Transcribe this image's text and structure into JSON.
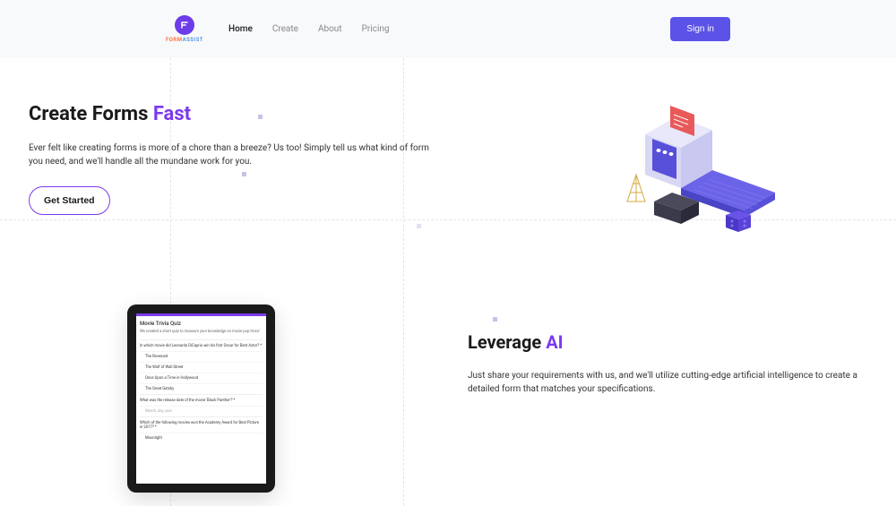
{
  "header": {
    "logo_text_1": "FORM",
    "logo_text_2": "ASSIST",
    "nav": [
      "Home",
      "Create",
      "About",
      "Pricing"
    ],
    "signin": "Sign in"
  },
  "hero": {
    "title_prefix": "Create Forms ",
    "title_highlight": "Fast",
    "description": "Ever felt like creating forms is more of a chore than a breeze? Us too! Simply tell us what kind of form you need, and we'll handle all the mundane work for you.",
    "cta": "Get Started"
  },
  "section2": {
    "title_prefix": "Leverage ",
    "title_highlight": "AI",
    "description": "Just share your requirements with us, and we'll utilize cutting-edge artificial intelligence to create a detailed form that matches your specifications."
  },
  "tablet": {
    "title": "Movie Trivia Quiz",
    "subtitle": "We created a short quiz to measure your knowledge on movie pop trivia!",
    "q1": "In which movie did Leonardo DiCaprio win his first Oscar for Best Actor? *",
    "opts": [
      "The Revenant",
      "The Wolf of Wall Street",
      "Once Upon a Time in Hollywood",
      "The Great Gatsby"
    ],
    "q2": "What was the release date of the movie 'Black Panther'? *",
    "q2_placeholder": "Month, day, year",
    "q3": "Which of the following movies won the Academy Award for Best Picture in 2017? *",
    "q3_opt": "Moonlight"
  }
}
